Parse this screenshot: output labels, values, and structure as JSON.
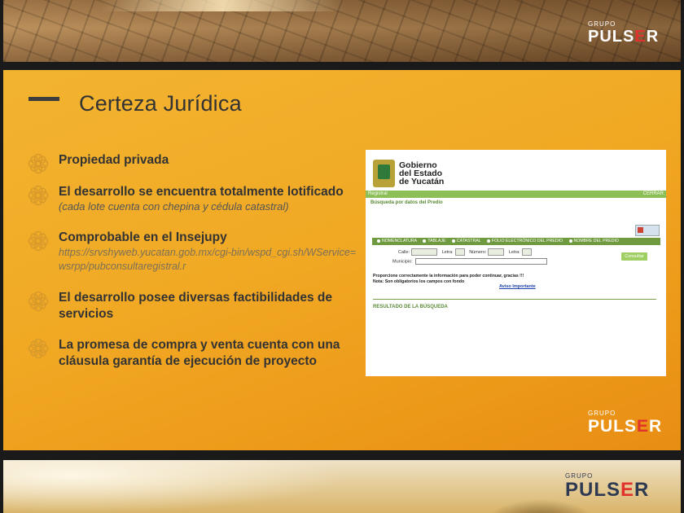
{
  "top_logo": {
    "grupo": "GRUPO",
    "pre": "PULS",
    "e": "E",
    "post": "R"
  },
  "main": {
    "title": "Certeza Jurídica",
    "items": [
      {
        "normal": "",
        "bold": "Propiedad privada",
        "rest": ""
      },
      {
        "normal": "El desarrollo se encuentra ",
        "bold": "totalmente lotificado",
        "rest": "",
        "sub": "(cada lote cuenta con chepina y cédula catastral)"
      },
      {
        "normal": "Comprobable en el ",
        "bold": "Insejupy",
        "rest": "",
        "link": "https://srvshyweb.yucatan.gob.mx/cgi-bin/wspd_cgi.sh/WService=wsrpp/pubconsultaregistral.r"
      },
      {
        "normal": "El desarrollo posee diversas ",
        "bold": "factibilidades",
        "rest": " de servicios"
      },
      {
        "normal": "",
        "bold": "La promesa de compra y venta",
        "rest": " cuenta con una cláusula garantía de ejecución de proyecto"
      }
    ],
    "screenshot": {
      "gov1": "Gobierno",
      "gov2": "del Estado",
      "gov3": "de Yucatán",
      "bar_left": "Registral",
      "bar_right": "CERRAR",
      "busqueda": "Búsqueda por datos del Predio",
      "options": [
        "NOMENCLATURA",
        "TABLAJE",
        "CATASTRAL",
        "FOLIO ELECTRÓNICO DEL PREDIO",
        "NOMBRE DEL PREDIO"
      ],
      "calle": "Calle:",
      "letra": "Letra:",
      "numero": "Número:",
      "letra2": "Letra:",
      "municipio": "Municipio:",
      "consultar": "Consultar",
      "prop1": "Proporcione correctamente la información para poder continuar, gracias !!!",
      "prop2": "Nota: Son obligatorios los campos con fondo",
      "aviso": "Aviso Importante",
      "resultado": "RESULTADO DE LA BÚSQUEDA"
    },
    "logo": {
      "grupo": "GRUPO",
      "pre": "PULS",
      "e": "E",
      "post": "R"
    }
  },
  "bottom_logo": {
    "grupo": "GRUPO",
    "pre": "PULS",
    "e": "E",
    "post": "R"
  },
  "colors": {
    "slide_bg": "#f1a924",
    "accent_red": "#e2322d",
    "gov_green": "#8cbf55"
  }
}
